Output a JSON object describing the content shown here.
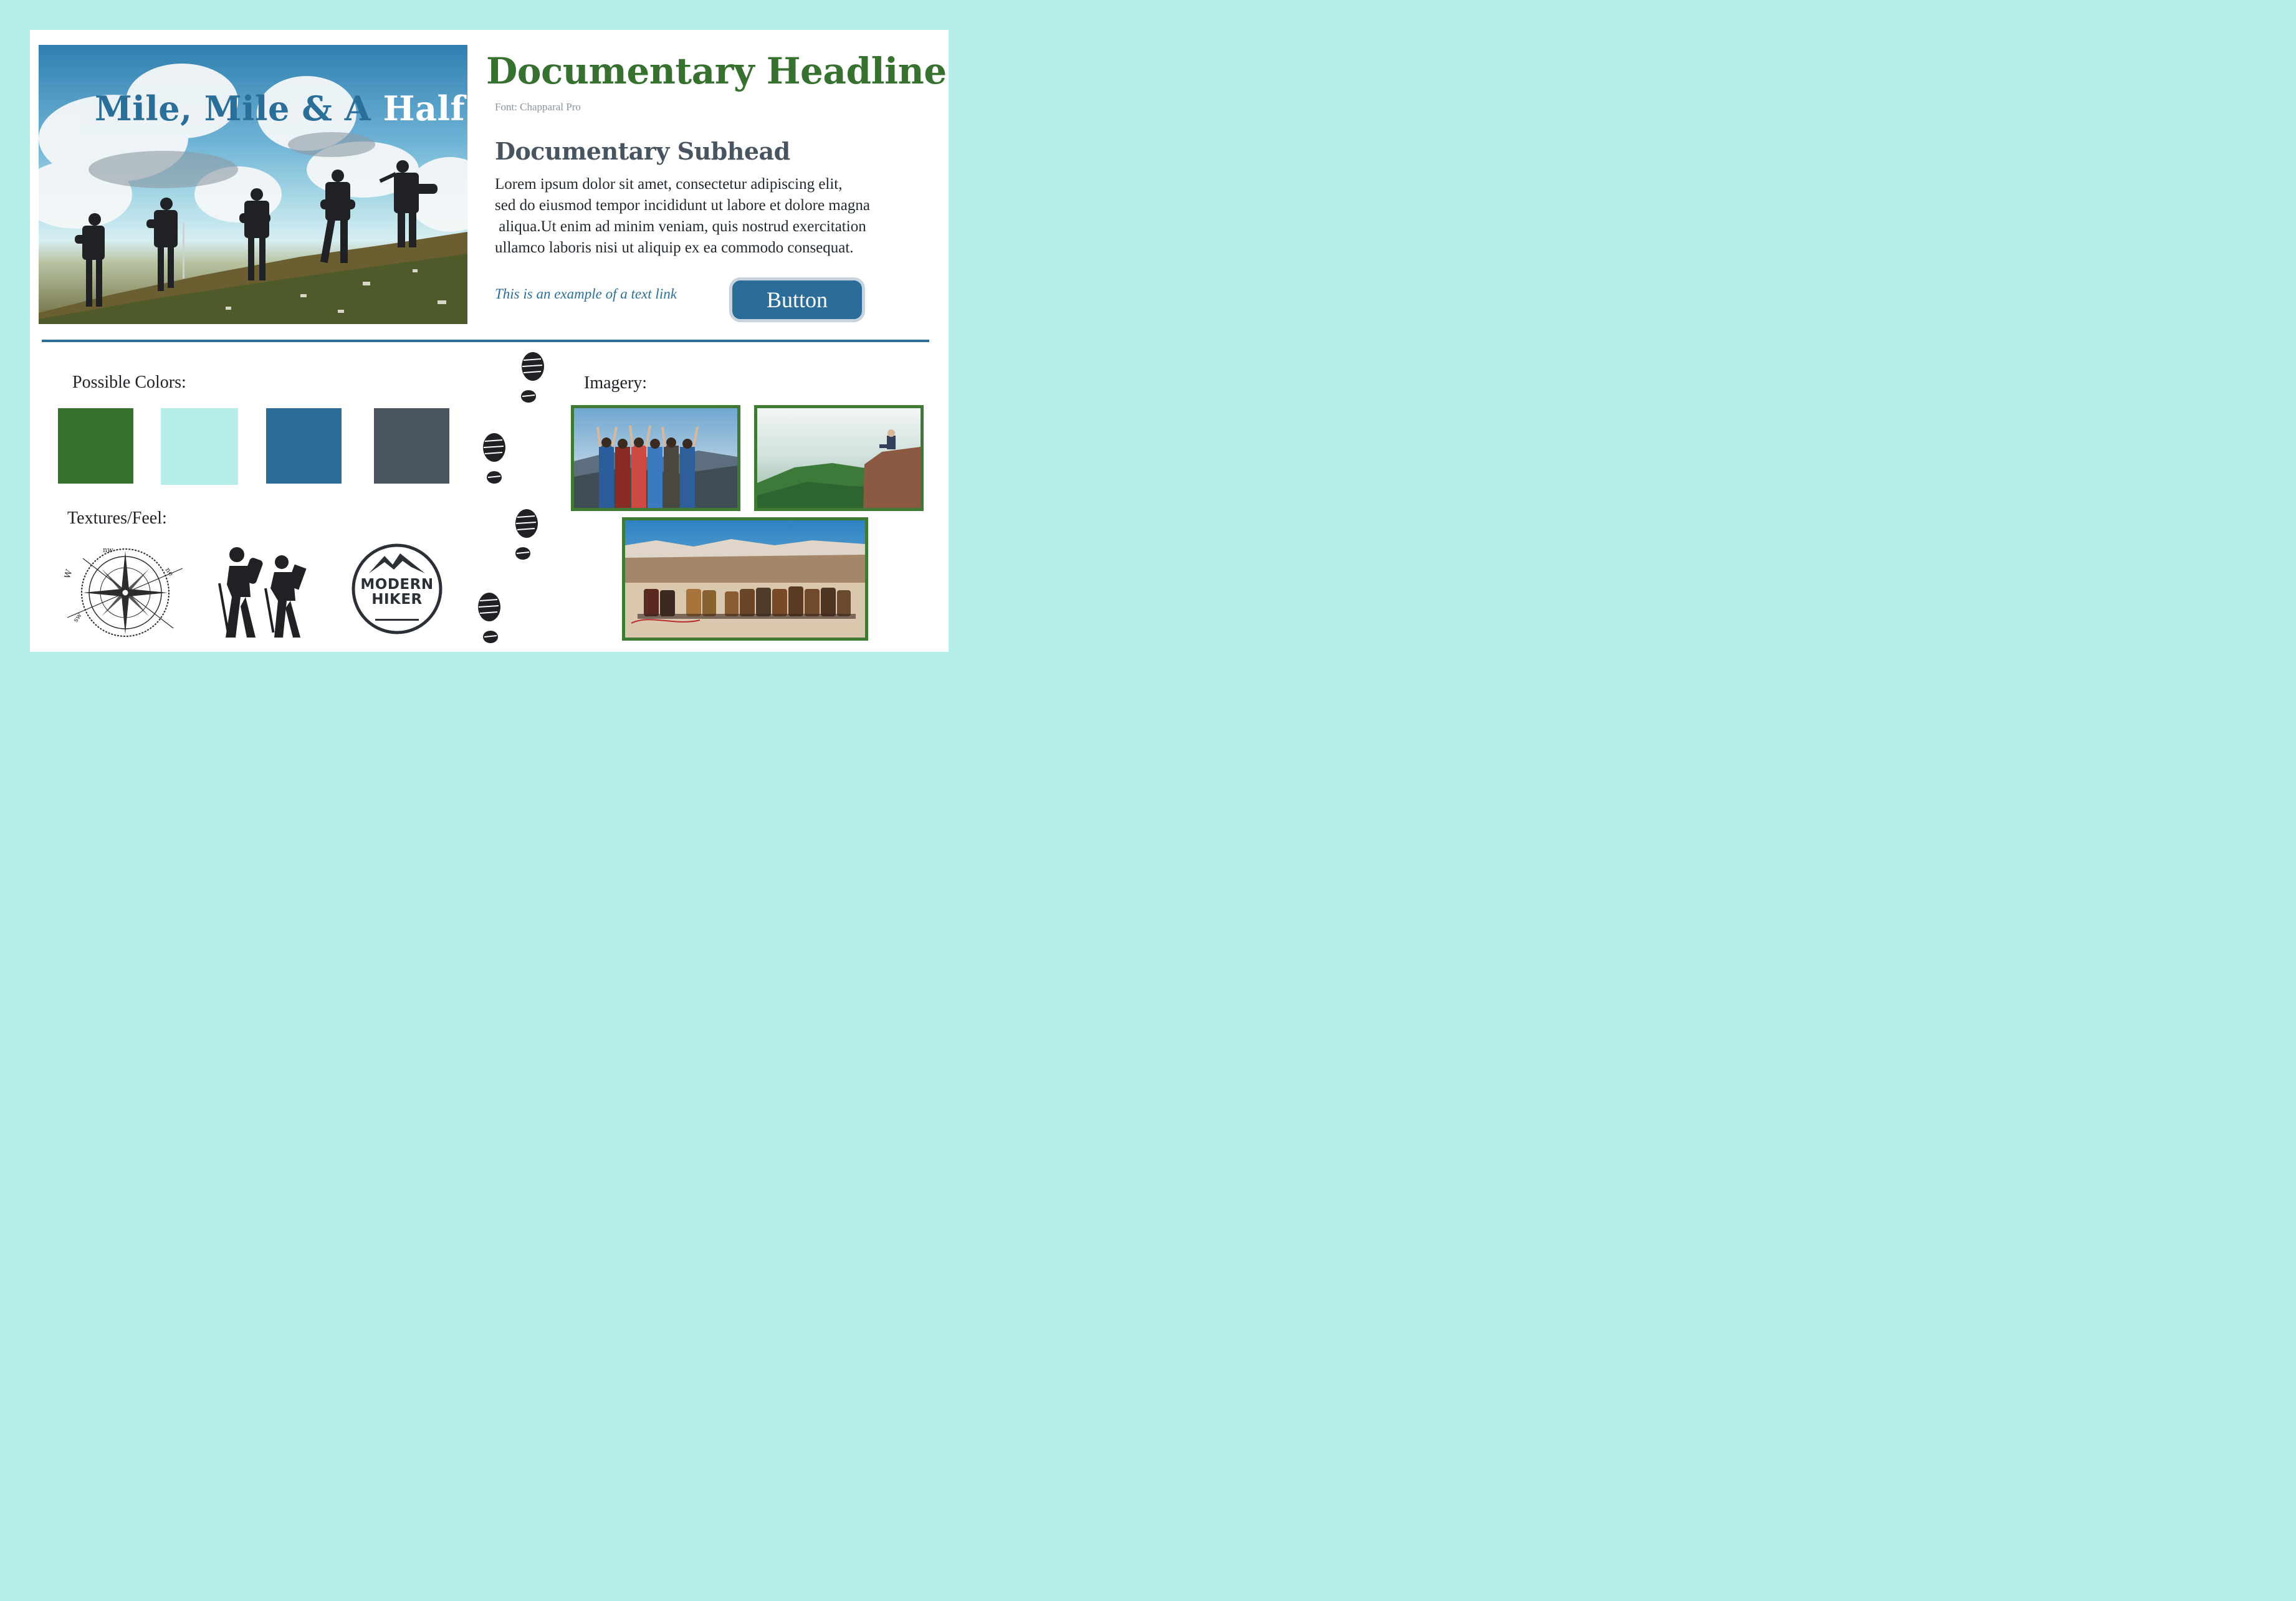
{
  "hero": {
    "title_part1": "Mile, Mile & A ",
    "title_part2": "Half"
  },
  "typography": {
    "headline": "Documentary Headline",
    "font_note": "Font: Chapparal Pro",
    "subhead": "Documentary Subhead",
    "body_lines": [
      "Lorem ipsum dolor sit amet, consectetur adipiscing elit,",
      "sed do eiusmod tempor incididunt ut labore et dolore magna",
      " aliqua.Ut enim ad minim veniam, quis nostrud exercitation",
      "ullamco laboris nisi ut aliquip ex ea commodo consequat."
    ],
    "link_text": "This is an example of a text link",
    "button_label": "Button"
  },
  "colors": {
    "label": "Possible Colors:",
    "swatches": [
      "#37712f",
      "#b4ede8",
      "#2c6c98",
      "#485560"
    ]
  },
  "textures": {
    "label": "Textures/Feel:",
    "compass_letters": [
      "W",
      "nw",
      "ne",
      "sw"
    ],
    "badge_line1": "MODERN",
    "badge_line2": "HIKER"
  },
  "imagery": {
    "label": "Imagery:"
  },
  "icons": [
    "footprint-icon",
    "compass-icon",
    "hikers-icon",
    "mountain-icon"
  ]
}
